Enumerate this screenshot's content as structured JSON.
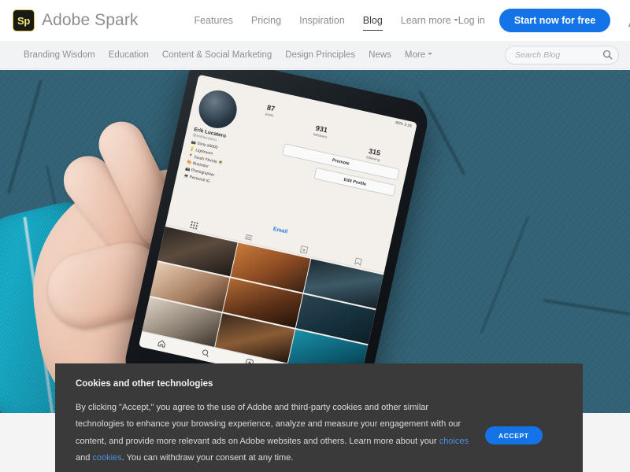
{
  "header": {
    "brand": {
      "mark": "Sp",
      "name": "Adobe Spark"
    },
    "nav": [
      {
        "label": "Features",
        "active": false
      },
      {
        "label": "Pricing",
        "active": false
      },
      {
        "label": "Inspiration",
        "active": false
      },
      {
        "label": "Blog",
        "active": true
      },
      {
        "label": "Learn more",
        "active": false,
        "has_caret": true
      }
    ],
    "login_label": "Log in",
    "cta_label": "Start now for free",
    "adobe_logo": "adobe-a-logo",
    "cta_color": "#1473e6"
  },
  "subnav": {
    "links": [
      "Branding Wisdom",
      "Education",
      "Content & Social Marketing",
      "Design Principles",
      "News",
      "More"
    ],
    "more_has_caret": true,
    "search": {
      "placeholder": "Search Blog",
      "value": "",
      "icon": "search-icon"
    }
  },
  "hero": {
    "alt": "Hand holding smartphone showing Instagram profile over blue concrete background",
    "phone": {
      "profile": {
        "name": "Erik Lucatero",
        "handle": "@eriklucatero",
        "bio": "📷 Sony a6000\n💡 Lightroom\n📍 South Florida 🌴\n🎨 Illustrator\n📸 Photographer\n💻 Personal IG",
        "stats": [
          {
            "value": "87",
            "label": "posts"
          },
          {
            "value": "931",
            "label": "followers"
          },
          {
            "value": "315",
            "label": "following"
          }
        ],
        "buttons": [
          "Promote",
          "Edit Profile"
        ],
        "email_label": "Email",
        "status_bar": "80%  3:16"
      }
    }
  },
  "cookie_banner": {
    "title": "Cookies and other technologies",
    "paragraph_part1": "By clicking \"Accept,\" you agree to the use of Adobe and third-party cookies and other similar technologies to enhance your browsing experience, analyze and measure your engagement with our content, and provide more relevant ads on Adobe websites and others. Learn more about your ",
    "link_choices": "choices",
    "between": " and ",
    "link_cookies": "cookies",
    "paragraph_part2": ". You can withdraw your consent at any time.",
    "accept_label": "ACCEPT",
    "background": "#3a3a3a",
    "link_color": "#4a90e2"
  }
}
